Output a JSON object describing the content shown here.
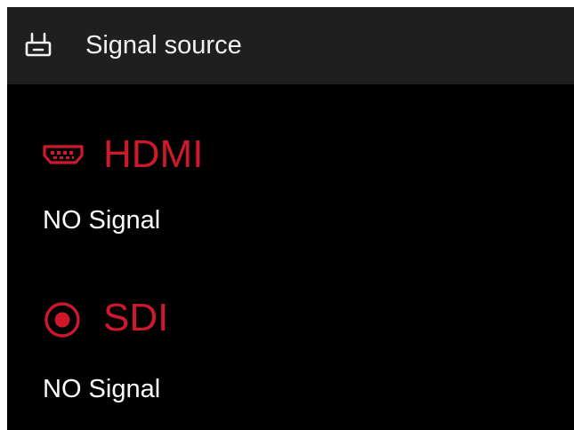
{
  "header": {
    "icon": "signal-source-icon",
    "title": "Signal source"
  },
  "sources": [
    {
      "name": "HDMI",
      "icon": "hdmi-port-icon",
      "status": "NO Signal"
    },
    {
      "name": "SDI",
      "icon": "radio-selected-icon",
      "status": "NO Signal",
      "selected": true
    }
  ],
  "colors": {
    "header_bg": "#1f1f1f",
    "background": "#000000",
    "accent": "#cc1a2c",
    "text": "#ffffff"
  }
}
